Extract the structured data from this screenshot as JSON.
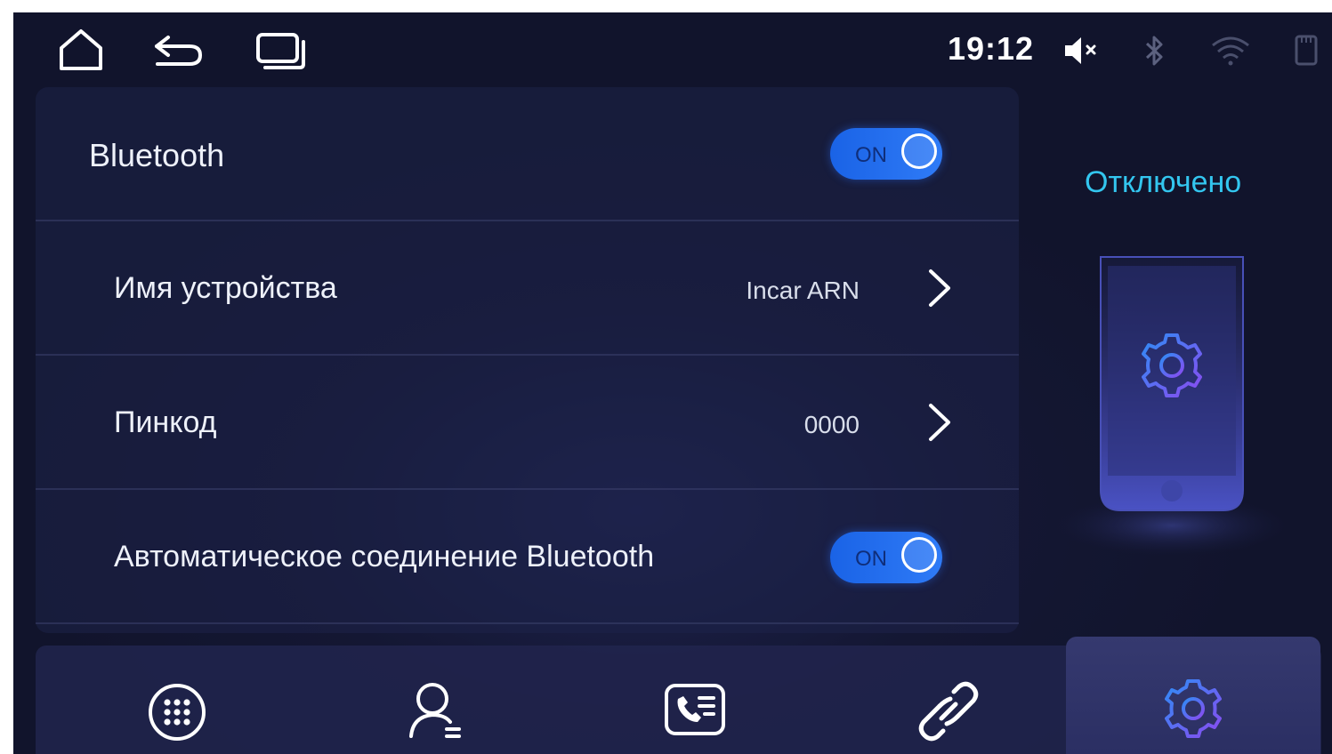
{
  "statusbar": {
    "time": "19:12",
    "icons": [
      "home-icon",
      "back-icon",
      "recent-apps-icon",
      "volume-muted-icon",
      "bluetooth-icon",
      "wifi-icon",
      "sd-card-icon"
    ]
  },
  "settings": {
    "bluetooth": {
      "label": "Bluetooth",
      "toggle_text": "ON",
      "enabled": true
    },
    "device_name": {
      "label": "Имя устройства",
      "value": "Incar ARN"
    },
    "pin": {
      "label": "Пинкод",
      "value": "0000"
    },
    "auto_connect": {
      "label": "Автоматическое соединение Bluetooth",
      "toggle_text": "ON",
      "enabled": true
    }
  },
  "side_panel": {
    "status": "Отключено",
    "icon": "gear-icon"
  },
  "bottom_nav": {
    "items": [
      {
        "name": "dialpad",
        "icon": "dialpad-icon"
      },
      {
        "name": "contacts",
        "icon": "contacts-icon"
      },
      {
        "name": "call-log",
        "icon": "call-log-icon"
      },
      {
        "name": "pairing",
        "icon": "link-icon"
      },
      {
        "name": "settings",
        "icon": "gear-icon",
        "active": true
      }
    ]
  },
  "colors": {
    "accent_blue": "#2f7bf7",
    "status_cyan": "#33c6ef",
    "background": "#141733"
  }
}
